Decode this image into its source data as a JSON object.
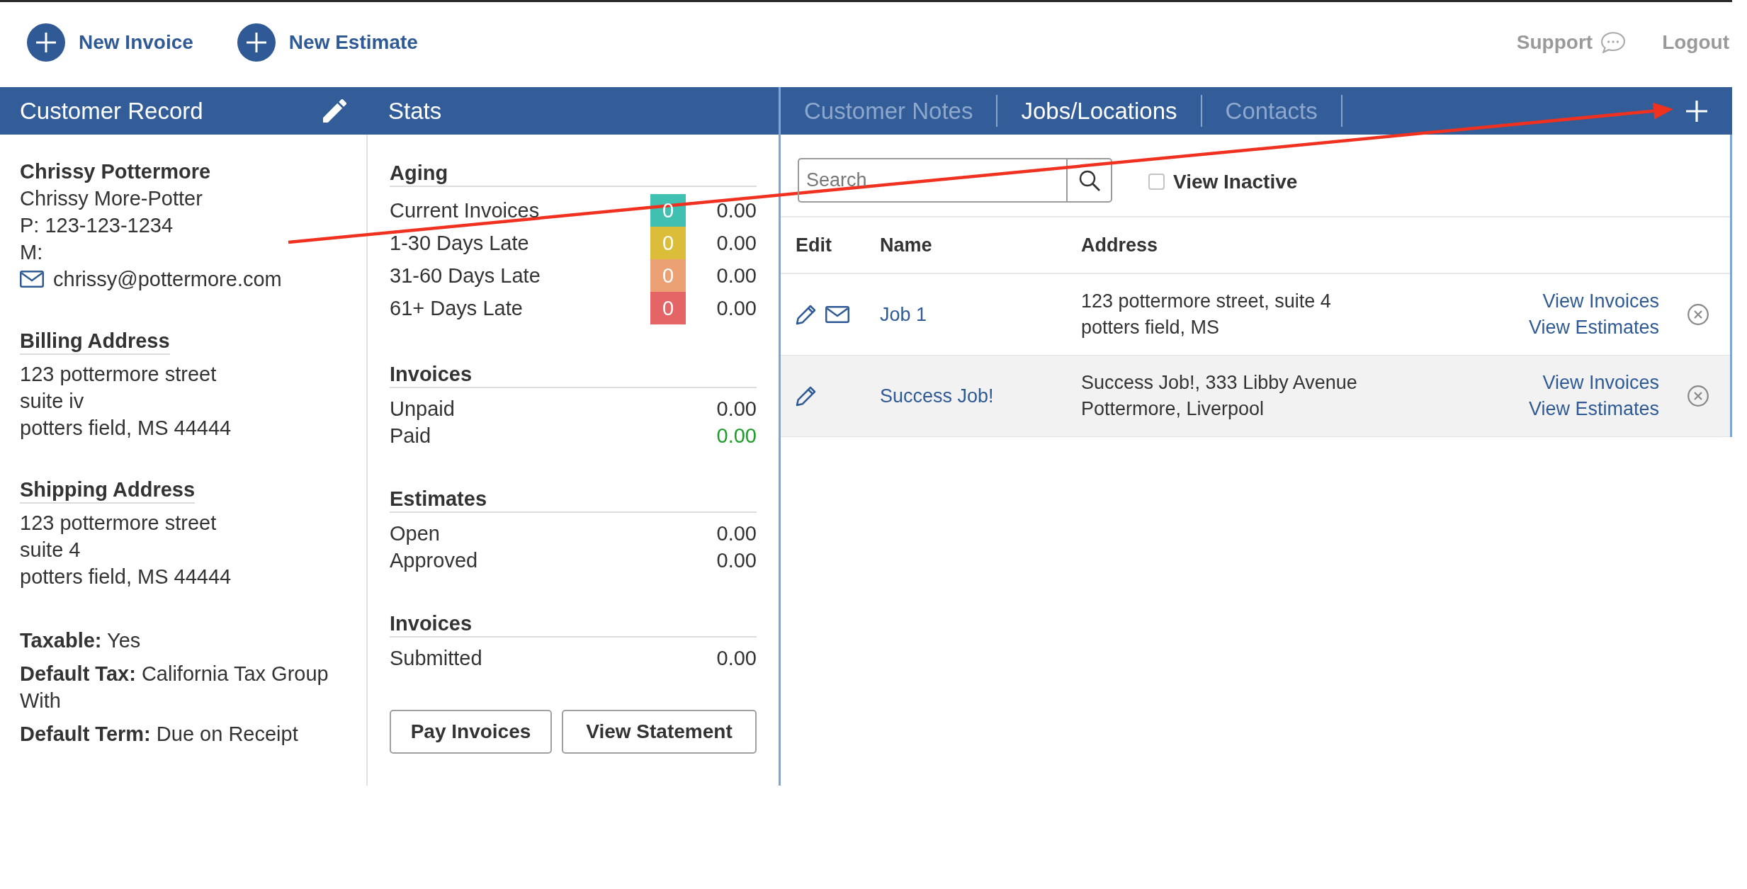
{
  "top_bar": {
    "actions": [
      "New Invoice",
      "New Estimate"
    ],
    "support": "Support",
    "logout": "Logout"
  },
  "customer_record": {
    "title": "Customer Record",
    "name": "Chrissy Pottermore",
    "contact": "Chrissy More-Potter",
    "phone": "P: 123-123-1234",
    "mobile": "M:",
    "email": "chrissy@pottermore.com",
    "addresses": [
      {
        "heading": "Billing Address",
        "lines": [
          "123 pottermore street",
          "suite iv",
          "potters field, MS 44444"
        ]
      },
      {
        "heading": "Shipping Address",
        "lines": [
          "123 pottermore street",
          "suite 4",
          "potters field, MS 44444"
        ]
      }
    ],
    "details": [
      "**Taxable:** Yes",
      "**Default Tax:** California Tax Group With",
      "**Default Term:** Due on Receipt"
    ]
  },
  "stats": {
    "title": "Stats",
    "sections": [
      {
        "heading": "Aging",
        "rows": [
          {
            "kind": "aging",
            "label": "Current Invoices",
            "count": "0",
            "color": "#40c0b1",
            "amount": "0.00"
          },
          {
            "kind": "aging",
            "label": "1-30 Days Late",
            "count": "0",
            "color": "#dbbd3a",
            "amount": "0.00"
          },
          {
            "kind": "aging",
            "label": "31-60 Days Late",
            "count": "0",
            "color": "#eca174",
            "amount": "0.00"
          },
          {
            "kind": "aging",
            "label": "61+ Days Late",
            "count": "0",
            "color": "#e56466",
            "amount": "0.00"
          }
        ]
      },
      {
        "heading": "Invoices",
        "rows": [
          {
            "kind": "plain",
            "label": "Unpaid",
            "amount": "0.00"
          },
          {
            "kind": "paid",
            "label": "Paid",
            "amount": "0.00"
          }
        ]
      },
      {
        "heading": "Estimates",
        "rows": [
          {
            "kind": "plain",
            "label": "Open",
            "amount": "0.00"
          },
          {
            "kind": "plain",
            "label": "Approved",
            "amount": "0.00"
          }
        ]
      },
      {
        "heading": "Invoices",
        "rows": [
          {
            "kind": "plain",
            "label": "Submitted",
            "amount": "0.00"
          }
        ]
      }
    ],
    "buttons": [
      "Pay Invoices",
      "View Statement"
    ]
  },
  "jobs": {
    "tabs": [
      {
        "label": "Customer Notes",
        "selected": false
      },
      {
        "label": "Jobs/Locations",
        "selected": true
      },
      {
        "label": "Contacts",
        "selected": false
      }
    ],
    "search": {
      "placeholder": "Search"
    },
    "view_inactive": {
      "label": "View Inactive",
      "checked": false
    },
    "table": {
      "columns": [
        "Edit",
        "Name",
        "Address"
      ],
      "rows": [
        {
          "name": "Job 1",
          "address": [
            "123 pottermore street, suite 4",
            "potters field, MS"
          ],
          "links": [
            "View Invoices",
            "View Estimates"
          ],
          "email": true,
          "highlighted": false
        },
        {
          "name": "Success Job!",
          "address": [
            "Success Job!, 333 Libby Avenue",
            "Pottermore, Liverpool"
          ],
          "links": [
            "View Invoices",
            "View Estimates"
          ],
          "email": false,
          "highlighted": true
        }
      ]
    }
  }
}
